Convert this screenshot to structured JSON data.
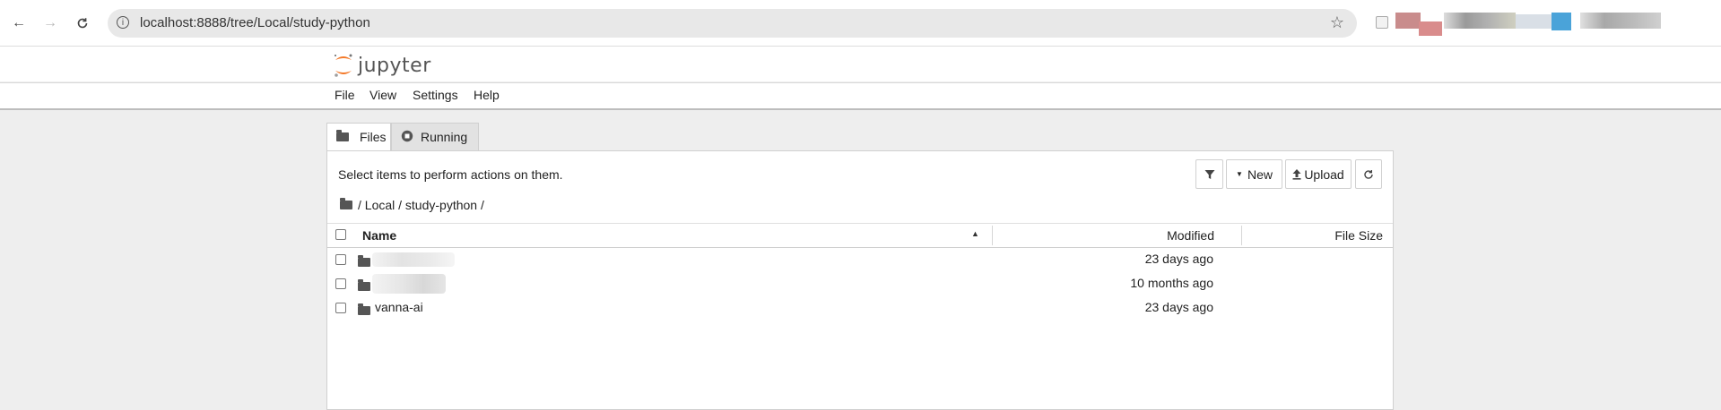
{
  "browser": {
    "url": "localhost:8888/tree/Local/study-python"
  },
  "app": {
    "logo_text": "jupyter",
    "menu": [
      "File",
      "View",
      "Settings",
      "Help"
    ]
  },
  "tabs": [
    {
      "label": "Files",
      "active": true
    },
    {
      "label": "Running",
      "active": false
    }
  ],
  "filebrowser": {
    "hint": "Select items to perform actions on them.",
    "toolbar": {
      "new_label": "New",
      "upload_label": "Upload"
    },
    "breadcrumb": "/ Local / study-python /",
    "columns": {
      "name": "Name",
      "modified": "Modified",
      "size": "File Size"
    },
    "rows": [
      {
        "name": "",
        "modified": "23 days ago",
        "type": "folder",
        "obscured": true
      },
      {
        "name": "",
        "modified": "10 months ago",
        "type": "folder",
        "obscured": true
      },
      {
        "name": "vanna-ai",
        "modified": "23 days ago",
        "type": "folder",
        "obscured": false
      }
    ]
  },
  "colors": {
    "jupyter_orange": "#F37726",
    "background": "#eeeeee"
  }
}
